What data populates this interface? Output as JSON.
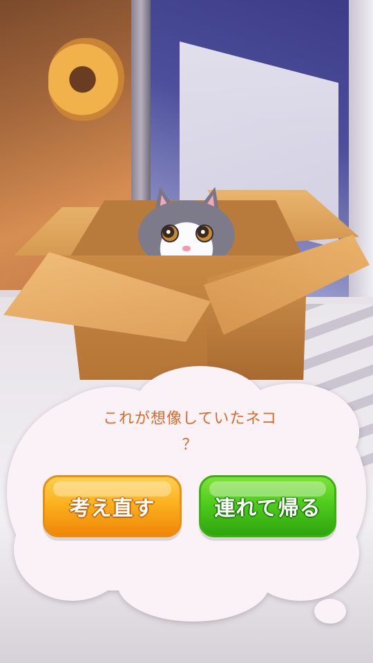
{
  "dialog": {
    "prompt_line1": "これが想像していたネコ",
    "prompt_line2": "？"
  },
  "buttons": {
    "rethink_label": "考え直す",
    "take_home_label": "連れて帰る"
  },
  "colors": {
    "prompt_text": "#d96a2c",
    "rethink_button": "#fbb11e",
    "take_home_button": "#4fcc1d",
    "cloud": "#faf2f6"
  }
}
